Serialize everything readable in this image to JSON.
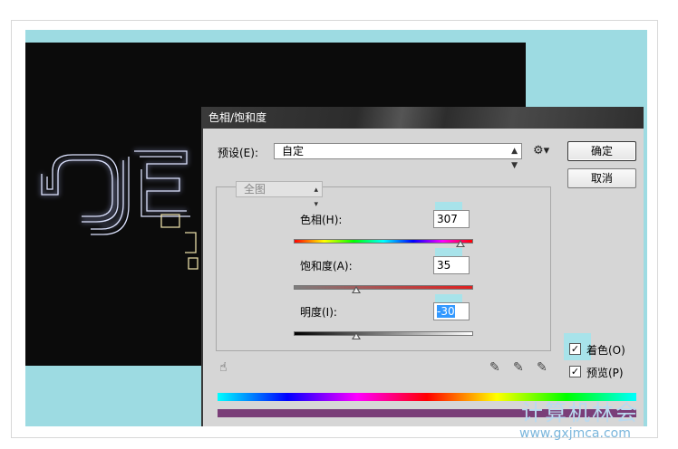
{
  "dialog": {
    "title": "色相/饱和度",
    "preset_label": "预设(E):",
    "preset_value": "自定",
    "ok_label": "确定",
    "cancel_label": "取消",
    "channel_value": "全图",
    "hue_label": "色相(H):",
    "hue_value": "307",
    "hue_fraction": 0.927,
    "saturation_label": "饱和度(A):",
    "saturation_value": "35",
    "saturation_fraction": 0.35,
    "lightness_label": "明度(I):",
    "lightness_value": "-30",
    "lightness_fraction": 0.35,
    "colorize_label": "着色(O)",
    "colorize_checked": true,
    "preview_label": "预览(P)",
    "preview_checked": true,
    "result_color": "#7a3e78"
  },
  "watermark": {
    "line1": "计算机林会",
    "line2": "www.gxjmca.com"
  }
}
